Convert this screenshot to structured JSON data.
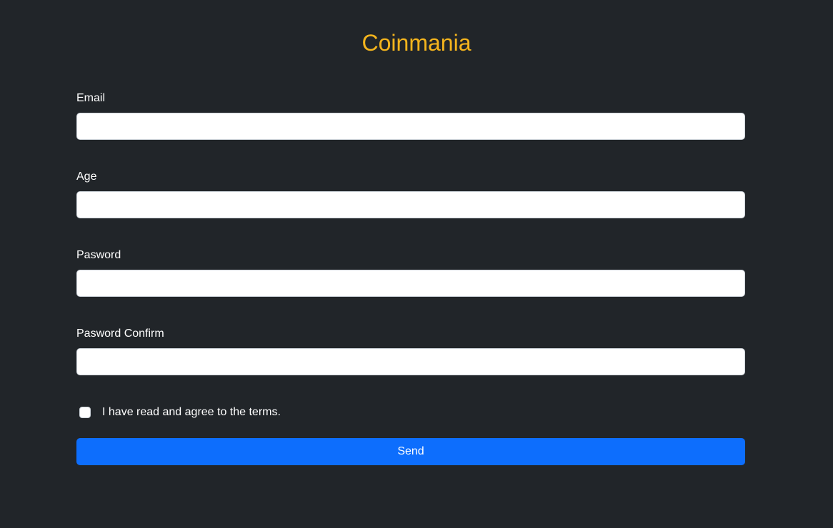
{
  "app": {
    "title": "Coinmania",
    "accent_color": "#f5b51d",
    "background_color": "#212529",
    "button_color": "#0d6efd"
  },
  "form": {
    "fields": [
      {
        "label": "Email",
        "value": "",
        "placeholder": ""
      },
      {
        "label": "Age",
        "value": "",
        "placeholder": ""
      },
      {
        "label": "Pasword",
        "value": "",
        "placeholder": ""
      },
      {
        "label": "Pasword Confirm",
        "value": "",
        "placeholder": ""
      }
    ],
    "terms": {
      "label": "I have read and agree to the terms.",
      "checked": false
    },
    "submit_label": "Send"
  }
}
